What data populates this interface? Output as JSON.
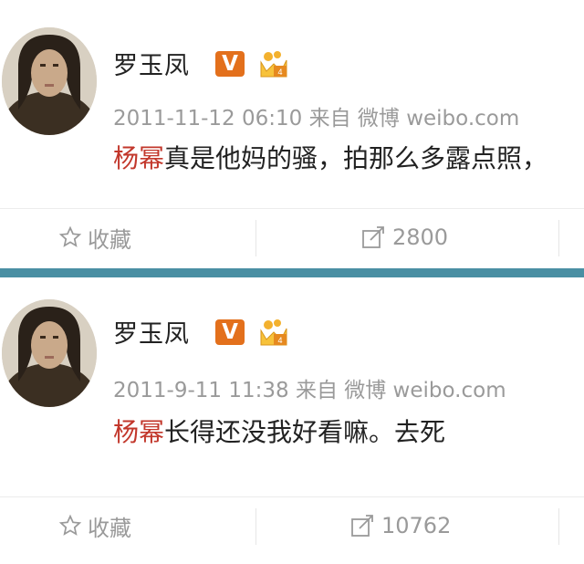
{
  "posts": [
    {
      "author": "罗玉凤",
      "verified_badge": "V",
      "timestamp": "2011-11-12 06:10",
      "source": "来自 微博 weibo.com",
      "mention": "杨幂",
      "text": "真是他妈的骚，拍那么多露点照，",
      "favorite_label": "收藏",
      "repost_count": "2800"
    },
    {
      "author": "罗玉凤",
      "verified_badge": "V",
      "timestamp": "2011-9-11 11:38",
      "source": "来自 微博 weibo.com",
      "mention": "杨幂",
      "text": "长得还没我好看嘛。去死",
      "favorite_label": "收藏",
      "repost_count": "10762"
    }
  ],
  "icons": {
    "favorite": "star-outline-icon",
    "repost": "repost-icon",
    "crown": "vip-crown-icon"
  },
  "colors": {
    "mention": "#c2372b",
    "badge": "#e3701c",
    "divider": "#4a8fa3",
    "meta": "#9a9a9a"
  }
}
